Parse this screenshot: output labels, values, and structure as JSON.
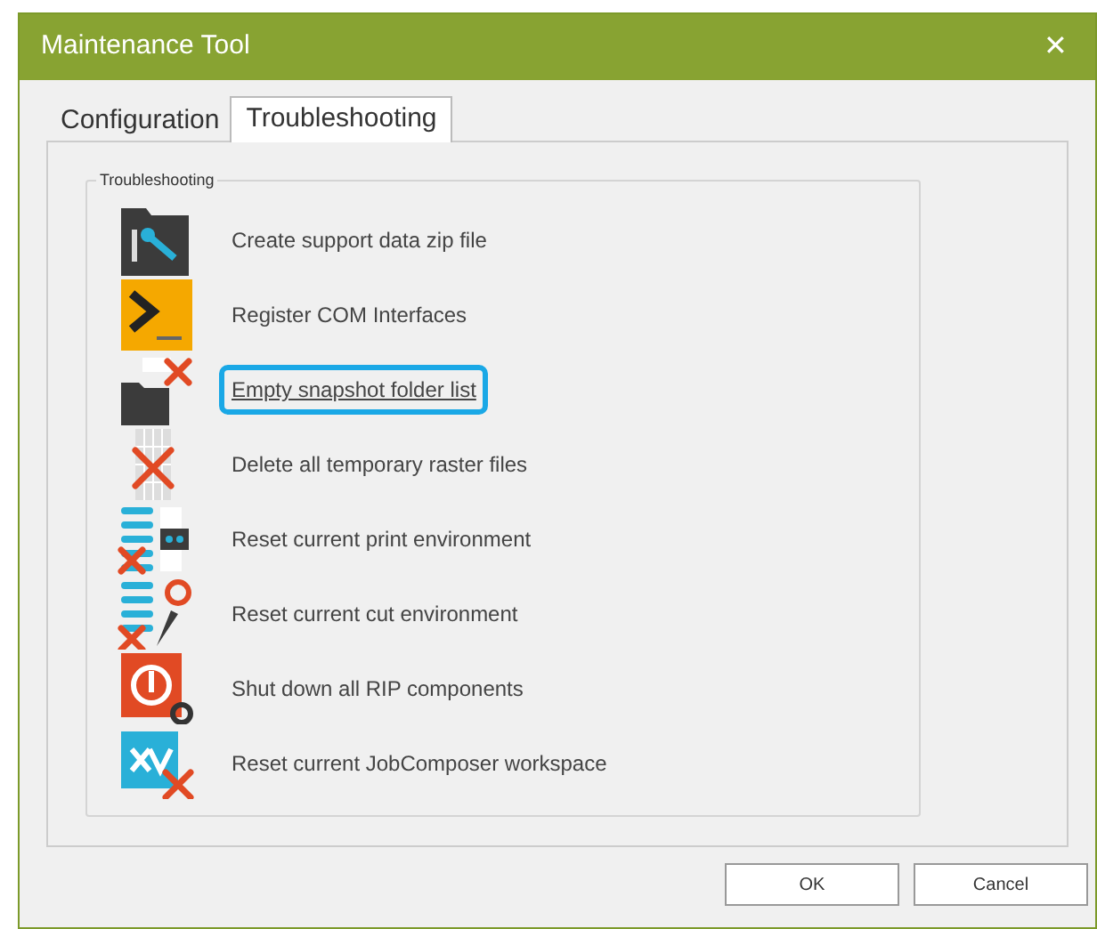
{
  "window": {
    "title": "Maintenance Tool",
    "close": "✕"
  },
  "tabs": [
    {
      "label": "Configuration",
      "selected": false
    },
    {
      "label": "Troubleshooting",
      "selected": true
    }
  ],
  "group": {
    "title": "Troubleshooting"
  },
  "actions": [
    {
      "kind": "support",
      "label": "Create support data zip file",
      "focused": false
    },
    {
      "kind": "terminal",
      "label": "Register COM Interfaces",
      "focused": false
    },
    {
      "kind": "folder",
      "label": "Empty snapshot folder list",
      "focused": true
    },
    {
      "kind": "raster",
      "label": "Delete all temporary raster files",
      "focused": false
    },
    {
      "kind": "print",
      "label": "Reset current print environment",
      "focused": false
    },
    {
      "kind": "cut",
      "label": "Reset current cut environment",
      "focused": false
    },
    {
      "kind": "shutdown",
      "label": "Shut down all RIP components",
      "focused": false
    },
    {
      "kind": "workspace",
      "label": "Reset current JobComposer workspace",
      "focused": false
    }
  ],
  "buttons": [
    "OK",
    "Cancel"
  ]
}
